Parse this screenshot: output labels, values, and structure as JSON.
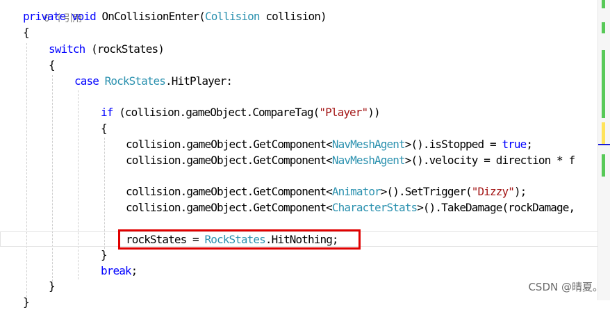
{
  "editor": {
    "reference_hint": "0 个引用",
    "lines": {
      "l1": {
        "kw1": "private",
        "sp1": " ",
        "kw2": "void",
        "txt1": " OnCollisionEnter(",
        "ty1": "Collision",
        "txt2": " collision)"
      },
      "l2": {
        "txt1": "{"
      },
      "l3": {
        "kw1": "switch",
        "txt1": " (rockStates)"
      },
      "l4": {
        "txt1": "{"
      },
      "l5": {
        "kw1": "case",
        "sp1": " ",
        "ty1": "RockStates",
        "txt1": ".HitPlayer:"
      },
      "l6": {
        "kw1": "if",
        "txt1": " (collision.gameObject.CompareTag(",
        "st1": "\"Player\"",
        "txt2": "))"
      },
      "l7": {
        "txt1": "{"
      },
      "l8": {
        "txt1": "collision.gameObject.GetComponent<",
        "ty1": "NavMeshAgent",
        "txt2": ">().isStopped = ",
        "kw1": "true",
        "txt3": ";"
      },
      "l9": {
        "txt1": "collision.gameObject.GetComponent<",
        "ty1": "NavMeshAgent",
        "txt2": ">().velocity = direction * f"
      },
      "l10": {
        "txt1": "collision.gameObject.GetComponent<",
        "ty1": "Animator",
        "txt2": ">().SetTrigger(",
        "st1": "\"Dizzy\"",
        "txt3": ");"
      },
      "l11": {
        "txt1": "collision.gameObject.GetComponent<",
        "ty1": "CharacterStats",
        "txt2": ">().TakeDamage(rockDamage,"
      },
      "l12": {
        "txt1": "rockStates = ",
        "ty1": "RockStates",
        "txt2": ".HitNothing;"
      },
      "l13": {
        "txt1": "}"
      },
      "l14": {
        "kw1": "break",
        "txt1": ";"
      },
      "l15": {
        "txt1": "}"
      },
      "l16": {
        "txt1": "}"
      }
    }
  },
  "watermark": "CSDN @晴夏。",
  "colors": {
    "keyword": "#0000ff",
    "type": "#2b91af",
    "string": "#a31515",
    "highlight_box": "#e00000",
    "change_marker_green": "#57c957",
    "change_marker_yellow": "#ffe35a",
    "caret_marker_blue": "#1b1bd8"
  }
}
